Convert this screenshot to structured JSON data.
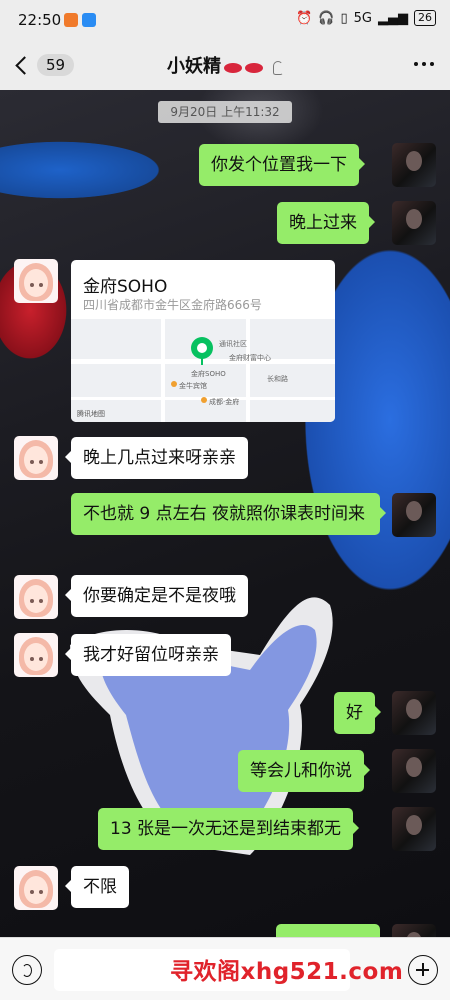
{
  "status_bar": {
    "time": "22:50",
    "network": "5G",
    "battery": "26"
  },
  "header": {
    "back_count": "59",
    "title": "小妖精",
    "title_emoji": "lips-emoji x2",
    "icons": [
      "back-chevron-icon",
      "ear-icon",
      "more-icon"
    ]
  },
  "chat": {
    "timestamp": "9月20日 上午11:32",
    "location": {
      "name": "金府SOHO",
      "address": "四川省成都市金牛区金府路666号",
      "map_labels": [
        "金府SOHO",
        "通讯社区",
        "金府财富中心",
        "金牛宾馆",
        "成都·金府",
        "长和路",
        "腾讯地图"
      ]
    },
    "messages": [
      {
        "from": "self",
        "text": "你发个位置我一下"
      },
      {
        "from": "self",
        "text": "晚上过来"
      },
      {
        "from": "other",
        "text": "晚上几点过来呀亲亲"
      },
      {
        "from": "self",
        "text": "不也就 9 点左右  夜就照你课表时间来"
      },
      {
        "from": "other",
        "text": "你要确定是不是夜哦"
      },
      {
        "from": "other",
        "text": "我才好留位呀亲亲"
      },
      {
        "from": "self",
        "text": "好"
      },
      {
        "from": "self",
        "text": "等会儿和你说"
      },
      {
        "from": "self",
        "text": "13 张是一次无还是到结束都无"
      },
      {
        "from": "other",
        "text": "不限"
      }
    ]
  },
  "input_bar": {
    "placeholder": "",
    "watermark": "寻欢阁xhg521.com",
    "icons": [
      "voice-icon",
      "plus-icon"
    ]
  },
  "colors": {
    "self_bubble": "#95ec69",
    "other_bubble": "#ffffff",
    "watermark": "#e0232b"
  }
}
